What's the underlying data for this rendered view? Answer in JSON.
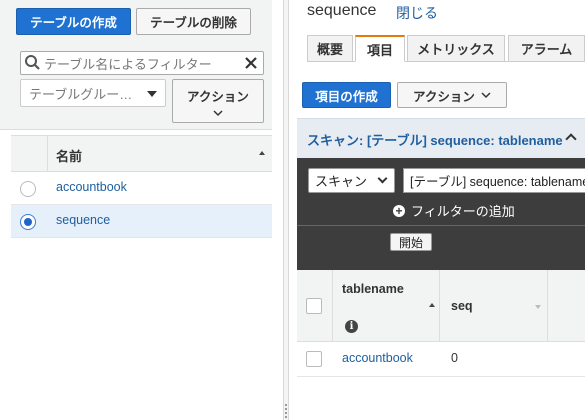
{
  "left": {
    "create_table_label": "テーブルの作成",
    "delete_table_label": "テーブルの削除",
    "filter_placeholder": "テーブル名によるフィルター",
    "table_group_placeholder": "テーブルグルー…",
    "actions_label": "アクション",
    "column_name": "名前",
    "tables": [
      {
        "name": "accountbook",
        "selected": false
      },
      {
        "name": "sequence",
        "selected": true
      }
    ]
  },
  "right": {
    "title": "sequence",
    "close_label": "閉じる",
    "tabs": [
      {
        "label": "概要",
        "active": false
      },
      {
        "label": "項目",
        "active": true
      },
      {
        "label": "メトリックス",
        "active": false
      },
      {
        "label": "アラーム",
        "active": false
      }
    ],
    "create_item_label": "項目の作成",
    "actions_label": "アクション",
    "scan_header": "スキャン: [テーブル] sequence: tablename",
    "scan_type_value": "スキャン",
    "scan_target_value": "[テーブル] sequence: tablename",
    "add_filter_label": "フィルターの追加",
    "start_label": "開始",
    "columns": [
      "tablename",
      "seq"
    ],
    "rows": [
      {
        "tablename": "accountbook",
        "seq": "0"
      }
    ]
  },
  "colors": {
    "primary": "#1f72d1",
    "link": "#1f5fa0",
    "dark_panel": "#3d3d3d",
    "active_tab_border": "#e47911"
  }
}
